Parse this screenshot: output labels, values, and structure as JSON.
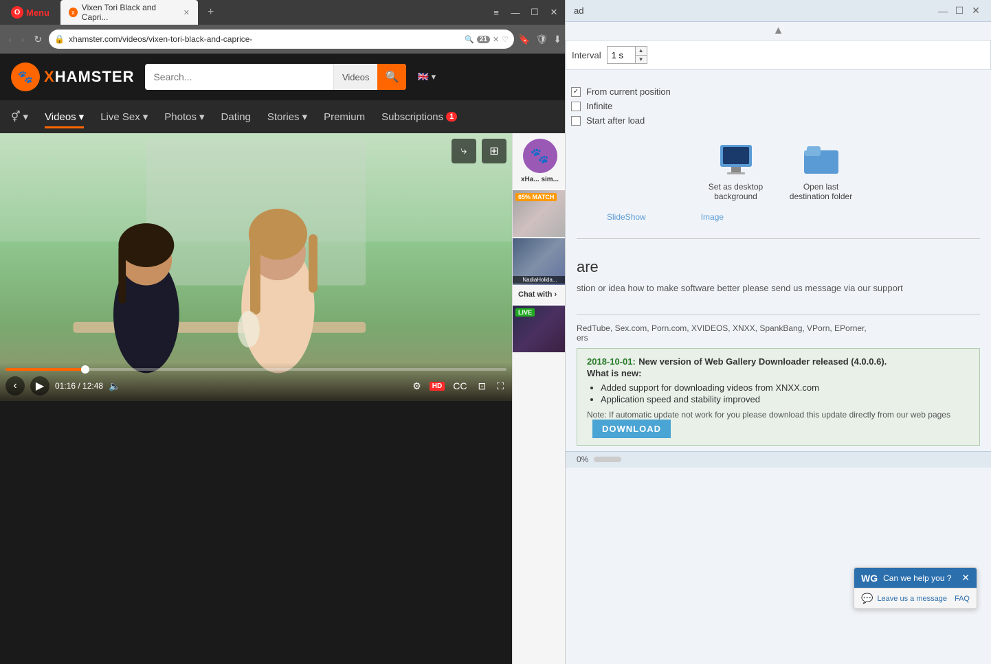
{
  "browser": {
    "title": "Vixen Tori Black and Capri...",
    "menu_label": "Menu",
    "tab_label": "Vixen Tori Black and Capri...",
    "address": "xhamster.com/videos/vixen-tori-black-and-caprice-",
    "tab_count": "21",
    "new_tab_label": "+",
    "window_controls": {
      "minimize": "—",
      "maximize": "☐",
      "close": "✕"
    },
    "nav": {
      "back": "‹",
      "forward": "›",
      "refresh": "↻"
    }
  },
  "site": {
    "logo": "XHAMSTER",
    "logo_x": "X",
    "search_placeholder": "Search...",
    "search_type": "Videos",
    "lang": "EN",
    "nav": {
      "gender_label": "⚥",
      "videos": "Videos",
      "live_sex": "Live Sex",
      "photos": "Photos",
      "dating": "Dating",
      "stories": "Stories",
      "premium": "Premium",
      "subscriptions": "Subscriptions",
      "sub_badge": "1"
    }
  },
  "video": {
    "time_current": "01:16",
    "time_total": "12:48",
    "hd_label": "HD"
  },
  "sidebar": {
    "profile_name": "xHa... sim...",
    "match_badge": "65% MATCH",
    "thumb2_label": "NadiaHolida...",
    "live_badge": "LIVE",
    "chat_title": "Chat with ›"
  },
  "wgd": {
    "title": "ad",
    "interval_label": "Interval",
    "interval_value": "1 s",
    "from_current": "From current position",
    "infinite": "Infinite",
    "start_after_load": "Start after load",
    "slideshow_label": "SlideShow",
    "image_label": "Image",
    "set_desktop_label": "Set as desktop background",
    "open_last_label": "Open last destination folder",
    "are_heading": "are",
    "are_text": "stion or idea how to make software better please send us message via our support",
    "news_date": "2018-10-01:",
    "news_title": "New version of Web Gallery Downloader released (4.0.0.6).",
    "news_subtitle": "What is new:",
    "news_items": [
      "Added support for downloading videos from XNXX.com",
      "Application speed and stability improved"
    ],
    "news_note": "Note: If automatic update not work for you please download this update directly from our web pages",
    "download_btn": "DOWNLOAD",
    "status_text": "0%",
    "partners_text": "RedTube, Sex.com, Porn.com, XVIDEOS, XNXX, SpankBang, VPorn, EPorner,",
    "partners_text2": "ers"
  },
  "chat_widget": {
    "logo_text": "WG",
    "text": "Can we help you ?",
    "leave_text": "Leave us a message",
    "faq_text": "FAQ",
    "close": "✕"
  }
}
